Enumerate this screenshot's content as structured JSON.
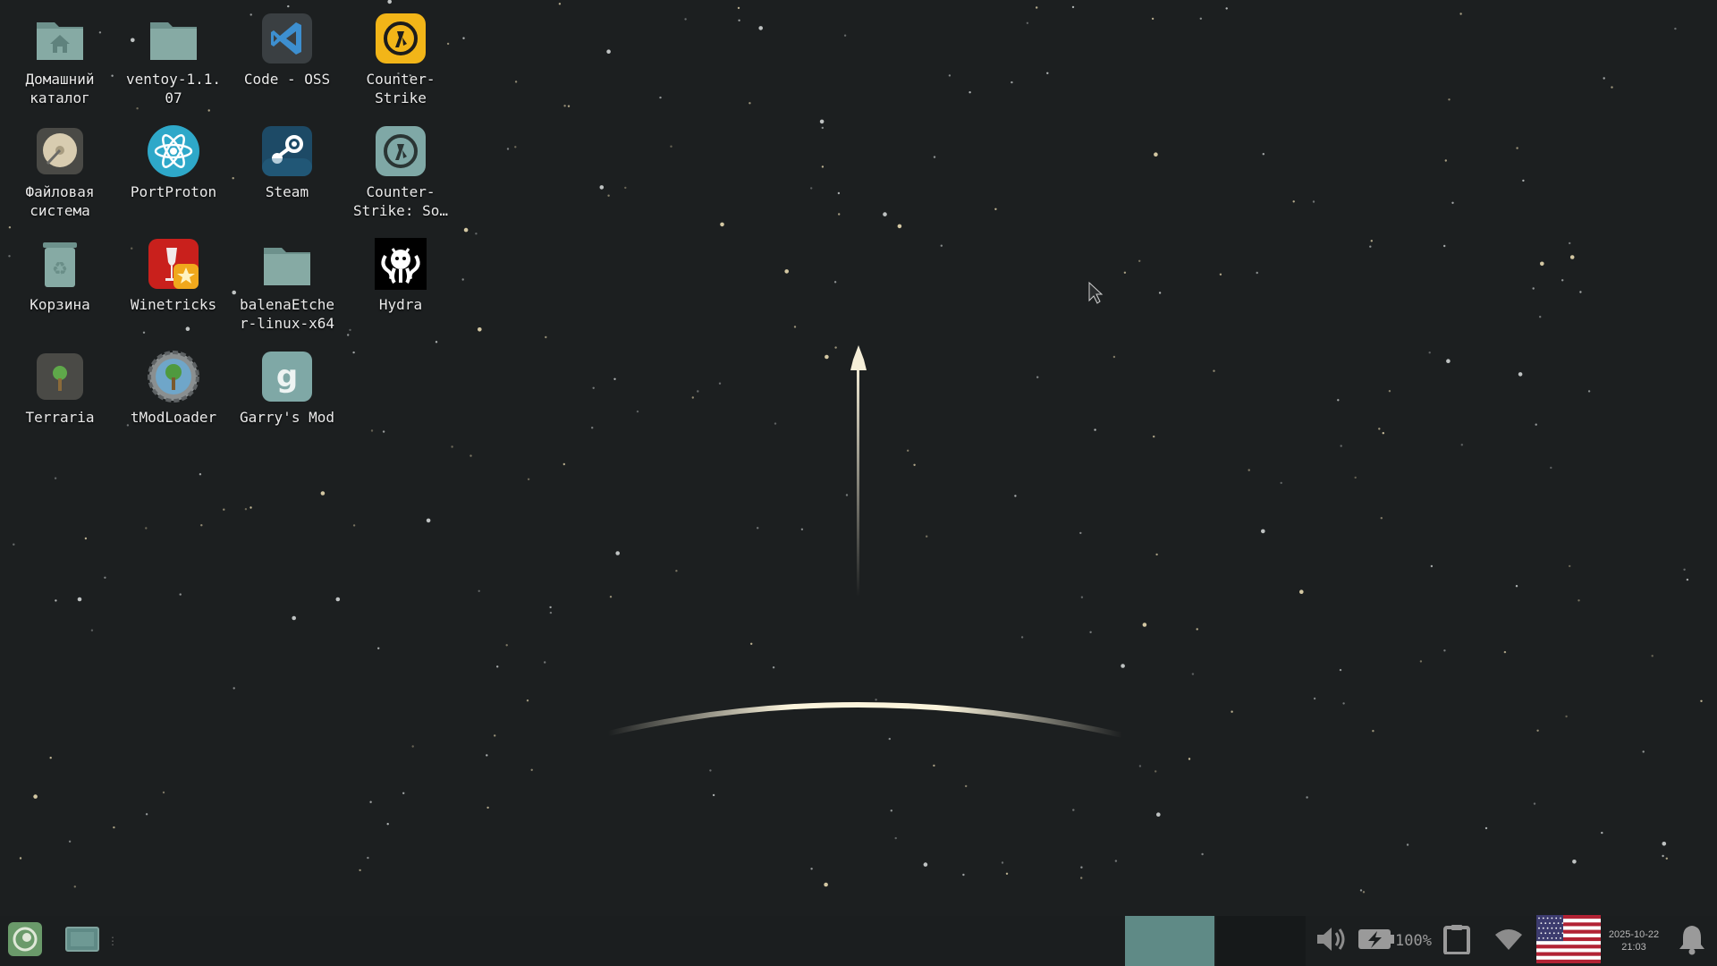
{
  "desktop": {
    "icons": [
      {
        "label": "Домашний\nкаталог",
        "icon": "home-folder-icon"
      },
      {
        "label": "ventoy-1.1.\n07",
        "icon": "folder-icon"
      },
      {
        "label": "Code - OSS",
        "icon": "vscode-icon"
      },
      {
        "label": "Counter-\nStrike",
        "icon": "counter-strike-icon"
      },
      {
        "label": "Файловая\nсистема",
        "icon": "hard-disk-icon"
      },
      {
        "label": "PortProton",
        "icon": "portproton-icon"
      },
      {
        "label": "Steam",
        "icon": "steam-icon"
      },
      {
        "label": "Counter-\nStrike: So…",
        "icon": "counter-strike-source-icon"
      },
      {
        "label": "Корзина",
        "icon": "trash-icon"
      },
      {
        "label": "Winetricks",
        "icon": "winetricks-icon"
      },
      {
        "label": "balenaEtche\nr-linux-x64",
        "icon": "folder-icon"
      },
      {
        "label": "Hydra",
        "icon": "hydra-icon"
      },
      {
        "label": "Terraria",
        "icon": "terraria-icon"
      },
      {
        "label": "tModLoader",
        "icon": "tmodloader-icon"
      },
      {
        "label": "Garry's Mod",
        "icon": "garrys-mod-icon"
      }
    ]
  },
  "taskbar": {
    "start_icon": "opensuse-menu-icon",
    "show_desktop_icon": "show-desktop-icon",
    "volume_icon": "volume-icon",
    "battery_icon": "battery-charging-icon",
    "battery_percent": "100%",
    "clipboard_icon": "clipboard-icon",
    "wifi_icon": "wifi-icon",
    "keyboard_layout_icon": "us-flag-icon",
    "clock": {
      "date": "2025-10-22",
      "time": "21:03"
    },
    "notifications_icon": "bell-icon"
  },
  "colors": {
    "background": "#1c1f20",
    "accent": "#5f8a86",
    "folder": "#7fa39e",
    "star": "#f0e6c8"
  }
}
